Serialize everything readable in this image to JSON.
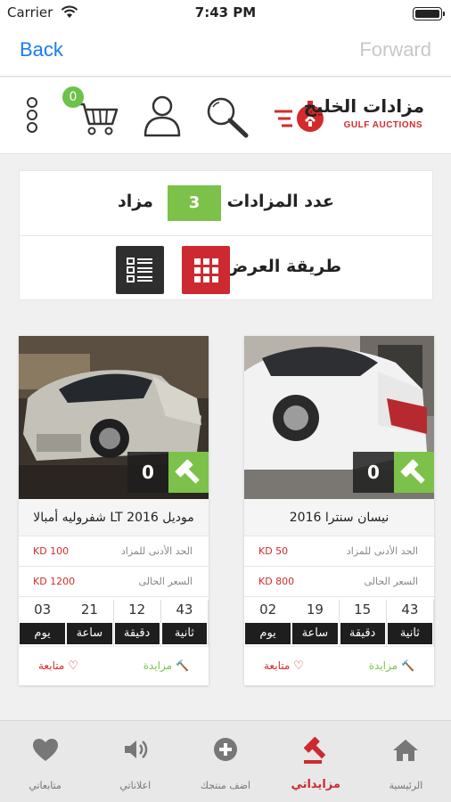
{
  "status_bar": {
    "carrier": "Carrier",
    "time": "7:43 PM"
  },
  "nav": {
    "back": "Back",
    "forward": "Forward"
  },
  "header": {
    "cart_count": "0",
    "logo_ar": "مزادات الخليج",
    "logo_en": "GULF AUCTIONS",
    "icons": [
      "more-icon",
      "cart-icon",
      "user-icon",
      "search-icon"
    ]
  },
  "summary": {
    "count_label": "عدد المزادات",
    "count": "3",
    "count_unit": "مزاد",
    "display_label": "طريقة العرض"
  },
  "cards": [
    {
      "title": "نيسان سنترا 2016",
      "bids": "0",
      "min_label": "الحد الأدنى للمزاد",
      "min_value": "KD 50",
      "current_label": "السعر الحالى",
      "current_value": "KD 800",
      "timer": [
        {
          "value": "43",
          "unit": "ثانية"
        },
        {
          "value": "15",
          "unit": "دقيقة"
        },
        {
          "value": "19",
          "unit": "ساعة"
        },
        {
          "value": "02",
          "unit": "يوم"
        }
      ],
      "bid_label": "مزايدة",
      "follow_label": "متابعة"
    },
    {
      "title": "موديل LT 2016 شفروليه أمبالا",
      "bids": "0",
      "min_label": "الحد الأدنى للمزاد",
      "min_value": "KD 100",
      "current_label": "السعر الحالى",
      "current_value": "KD 1200",
      "timer": [
        {
          "value": "43",
          "unit": "ثانية"
        },
        {
          "value": "12",
          "unit": "دقيقة"
        },
        {
          "value": "21",
          "unit": "ساعة"
        },
        {
          "value": "03",
          "unit": "يوم"
        }
      ],
      "bid_label": "مزايدة",
      "follow_label": "متابعة"
    }
  ],
  "tabs": [
    {
      "label": "الرئيسية",
      "icon": "home-icon"
    },
    {
      "label": "مزايداتي",
      "icon": "gavel-icon",
      "active": true
    },
    {
      "label": "اضف منتجك",
      "icon": "add-icon"
    },
    {
      "label": "اعلاناتي",
      "icon": "speaker-icon"
    },
    {
      "label": "متابعاتي",
      "icon": "heart-icon"
    }
  ],
  "colors": {
    "accent_green": "#7cc24a",
    "accent_red": "#cc2a30",
    "link_blue": "#1a7cf0"
  }
}
